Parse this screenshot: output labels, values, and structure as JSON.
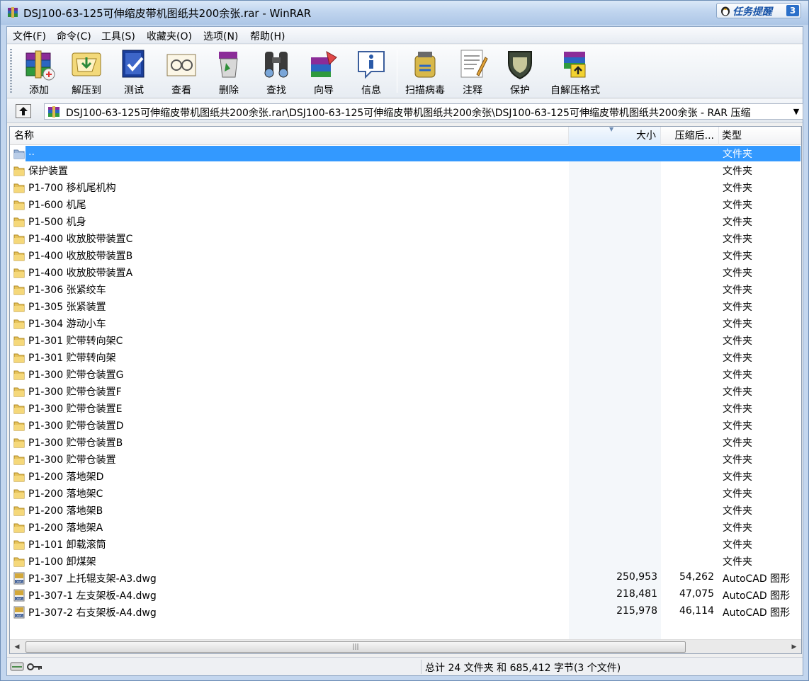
{
  "window": {
    "title": "DSJ100-63-125可伸缩皮带机图纸共200余张.rar - WinRAR",
    "task_badge": {
      "label": "任务提醒",
      "count": "3"
    }
  },
  "menu": [
    "文件(F)",
    "命令(C)",
    "工具(S)",
    "收藏夹(O)",
    "选项(N)",
    "帮助(H)"
  ],
  "toolbar": [
    {
      "label": "添加",
      "icon": "add-archive-icon"
    },
    {
      "label": "解压到",
      "icon": "extract-to-icon"
    },
    {
      "label": "测试",
      "icon": "test-icon"
    },
    {
      "label": "查看",
      "icon": "view-icon"
    },
    {
      "label": "删除",
      "icon": "delete-icon"
    },
    {
      "label": "查找",
      "icon": "find-icon"
    },
    {
      "label": "向导",
      "icon": "wizard-icon"
    },
    {
      "label": "信息",
      "icon": "info-icon"
    },
    {
      "label": "扫描病毒",
      "icon": "virus-scan-icon"
    },
    {
      "label": "注释",
      "icon": "comment-icon"
    },
    {
      "label": "保护",
      "icon": "protect-icon"
    },
    {
      "label": "自解压格式",
      "icon": "sfx-icon"
    }
  ],
  "address": {
    "path": "DSJ100-63-125可伸缩皮带机图纸共200余张.rar\\DSJ100-63-125可伸缩皮带机图纸共200余张\\DSJ100-63-125可伸缩皮带机图纸共200余张 - RAR 压缩"
  },
  "columns": {
    "name": "名称",
    "size": "大小",
    "packed": "压缩后...",
    "type": "类型"
  },
  "rows": [
    {
      "name": "..",
      "size": "",
      "packed": "",
      "type": "文件夹",
      "kind": "parent",
      "selected": true
    },
    {
      "name": "保护装置",
      "size": "",
      "packed": "",
      "type": "文件夹",
      "kind": "folder"
    },
    {
      "name": "P1-700 移机尾机构",
      "size": "",
      "packed": "",
      "type": "文件夹",
      "kind": "folder"
    },
    {
      "name": "P1-600 机尾",
      "size": "",
      "packed": "",
      "type": "文件夹",
      "kind": "folder"
    },
    {
      "name": "P1-500 机身",
      "size": "",
      "packed": "",
      "type": "文件夹",
      "kind": "folder"
    },
    {
      "name": "P1-400 收放胶带装置C",
      "size": "",
      "packed": "",
      "type": "文件夹",
      "kind": "folder"
    },
    {
      "name": "P1-400 收放胶带装置B",
      "size": "",
      "packed": "",
      "type": "文件夹",
      "kind": "folder"
    },
    {
      "name": "P1-400 收放胶带装置A",
      "size": "",
      "packed": "",
      "type": "文件夹",
      "kind": "folder"
    },
    {
      "name": "P1-306 张紧绞车",
      "size": "",
      "packed": "",
      "type": "文件夹",
      "kind": "folder"
    },
    {
      "name": "P1-305 张紧装置",
      "size": "",
      "packed": "",
      "type": "文件夹",
      "kind": "folder"
    },
    {
      "name": "P1-304 游动小车",
      "size": "",
      "packed": "",
      "type": "文件夹",
      "kind": "folder"
    },
    {
      "name": "P1-301 贮带转向架C",
      "size": "",
      "packed": "",
      "type": "文件夹",
      "kind": "folder"
    },
    {
      "name": "P1-301 贮带转向架",
      "size": "",
      "packed": "",
      "type": "文件夹",
      "kind": "folder"
    },
    {
      "name": "P1-300 贮带仓装置G",
      "size": "",
      "packed": "",
      "type": "文件夹",
      "kind": "folder"
    },
    {
      "name": "P1-300 贮带仓装置F",
      "size": "",
      "packed": "",
      "type": "文件夹",
      "kind": "folder"
    },
    {
      "name": "P1-300 贮带仓装置E",
      "size": "",
      "packed": "",
      "type": "文件夹",
      "kind": "folder"
    },
    {
      "name": "P1-300 贮带仓装置D",
      "size": "",
      "packed": "",
      "type": "文件夹",
      "kind": "folder"
    },
    {
      "name": "P1-300 贮带仓装置B",
      "size": "",
      "packed": "",
      "type": "文件夹",
      "kind": "folder"
    },
    {
      "name": "P1-300 贮带仓装置",
      "size": "",
      "packed": "",
      "type": "文件夹",
      "kind": "folder"
    },
    {
      "name": "P1-200 落地架D",
      "size": "",
      "packed": "",
      "type": "文件夹",
      "kind": "folder"
    },
    {
      "name": "P1-200 落地架C",
      "size": "",
      "packed": "",
      "type": "文件夹",
      "kind": "folder"
    },
    {
      "name": "P1-200 落地架B",
      "size": "",
      "packed": "",
      "type": "文件夹",
      "kind": "folder"
    },
    {
      "name": "P1-200 落地架A",
      "size": "",
      "packed": "",
      "type": "文件夹",
      "kind": "folder"
    },
    {
      "name": "P1-101 卸载滚筒",
      "size": "",
      "packed": "",
      "type": "文件夹",
      "kind": "folder"
    },
    {
      "name": "P1-100 卸煤架",
      "size": "",
      "packed": "",
      "type": "文件夹",
      "kind": "folder"
    },
    {
      "name": "P1-307 上托辊支架-A3.dwg",
      "size": "250,953",
      "packed": "54,262",
      "type": "AutoCAD 图形",
      "kind": "dwg"
    },
    {
      "name": "P1-307-1 左支架板-A4.dwg",
      "size": "218,481",
      "packed": "47,075",
      "type": "AutoCAD 图形",
      "kind": "dwg"
    },
    {
      "name": "P1-307-2 右支架板-A4.dwg",
      "size": "215,978",
      "packed": "46,114",
      "type": "AutoCAD 图形",
      "kind": "dwg"
    }
  ],
  "status": {
    "summary": "总计 24 文件夹 和 685,412 字节(3 个文件)"
  }
}
